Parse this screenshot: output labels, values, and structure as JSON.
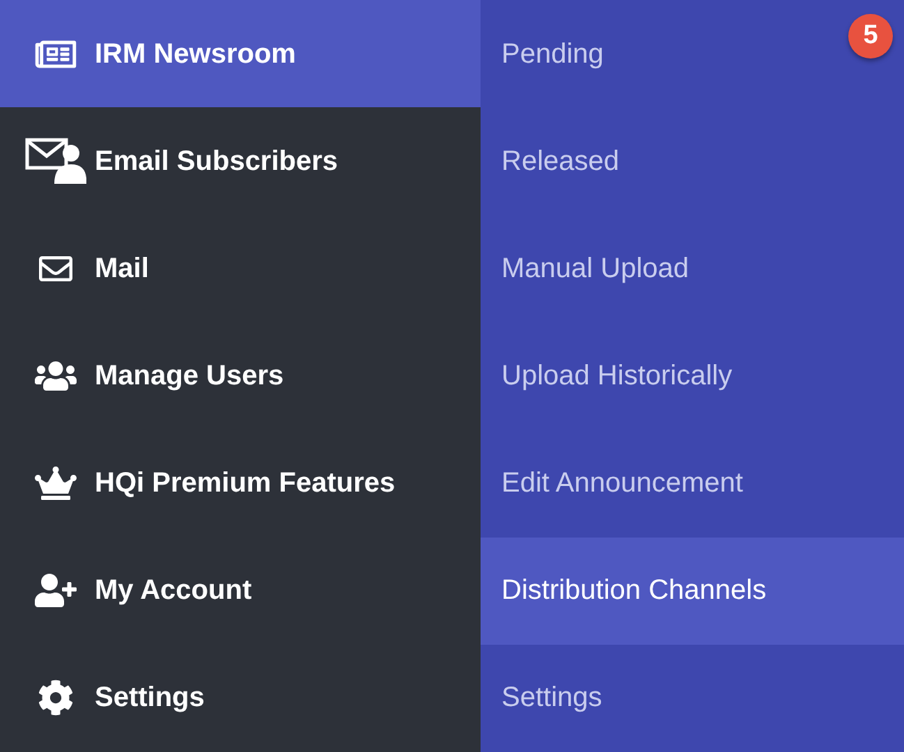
{
  "main_menu": [
    {
      "label": "IRM Newsroom",
      "selected": true
    },
    {
      "label": "Email Subscribers",
      "selected": false
    },
    {
      "label": "Mail",
      "selected": false
    },
    {
      "label": "Manage Users",
      "selected": false
    },
    {
      "label": "HQi Premium Features",
      "selected": false
    },
    {
      "label": "My Account",
      "selected": false
    },
    {
      "label": "Settings",
      "selected": false
    }
  ],
  "submenu": [
    {
      "label": "Pending",
      "selected": false,
      "badge": "5"
    },
    {
      "label": "Released",
      "selected": false
    },
    {
      "label": "Manual Upload",
      "selected": false
    },
    {
      "label": "Upload Historically",
      "selected": false
    },
    {
      "label": "Edit Announcement",
      "selected": false
    },
    {
      "label": "Distribution Channels",
      "selected": true
    },
    {
      "label": "Settings",
      "selected": false
    }
  ]
}
